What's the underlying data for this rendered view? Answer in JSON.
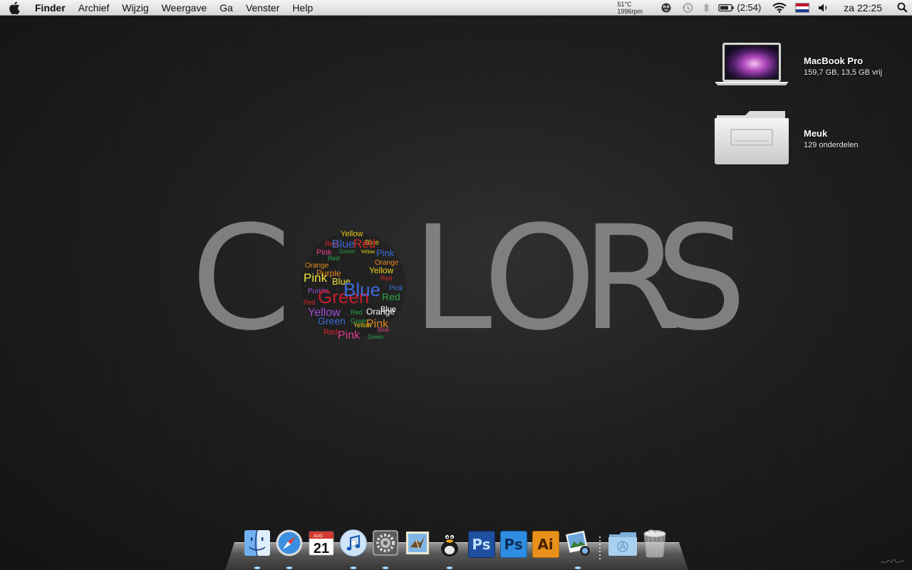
{
  "menubar": {
    "app_name": "Finder",
    "items": [
      "Archief",
      "Wijzig",
      "Weergave",
      "Ga",
      "Venster",
      "Help"
    ],
    "temperature": "51°C",
    "fan_speed": "1996rpm",
    "battery_time": "(2:54)",
    "clock": "za 22:25"
  },
  "desktop": {
    "items": [
      {
        "name": "MacBook Pro",
        "detail": "159,7 GB, 13,5 GB vrij",
        "icon": "laptop-icon"
      },
      {
        "name": "Meuk",
        "detail": "129 onderdelen",
        "icon": "folder-icon"
      }
    ]
  },
  "wallpaper": {
    "letters": [
      "C",
      "L",
      "O",
      "R",
      "S"
    ],
    "cloud_words": [
      {
        "t": "Yellow",
        "c": "#e8d21a"
      },
      {
        "t": "Red",
        "c": "#d8262a"
      },
      {
        "t": "Blue",
        "c": "#3d6bd8"
      },
      {
        "t": "Blue",
        "c": "#f0c21c"
      },
      {
        "t": "Red",
        "c": "#d8262a"
      },
      {
        "t": "Pink",
        "c": "#e23f8e"
      },
      {
        "t": "Green",
        "c": "#2aa44a"
      },
      {
        "t": "Yellow",
        "c": "#e8d21a"
      },
      {
        "t": "Pink",
        "c": "#3d6bd8"
      },
      {
        "t": "Red",
        "c": "#2aa44a"
      },
      {
        "t": "Orange",
        "c": "#e58a1f"
      },
      {
        "t": "Orange",
        "c": "#e58a1f"
      },
      {
        "t": "Purple",
        "c": "#e58a1f"
      },
      {
        "t": "Yellow",
        "c": "#e8d21a"
      },
      {
        "t": "Pink",
        "c": "#f0e13a"
      },
      {
        "t": "Red",
        "c": "#d8262a"
      },
      {
        "t": "Blue",
        "c": "#f0e13a"
      },
      {
        "t": "Purple",
        "c": "#9c4ed8"
      },
      {
        "t": "Pink",
        "c": "#3d6bd8"
      },
      {
        "t": "Red",
        "c": "#d8262a"
      },
      {
        "t": "Green",
        "c": "#c41e2c"
      },
      {
        "t": "Red",
        "c": "#2aa44a"
      },
      {
        "t": "Blue",
        "c": "#3d6bd8"
      },
      {
        "t": "Blue",
        "c": "#ffffff"
      },
      {
        "t": "Yellow",
        "c": "#9c4ed8"
      },
      {
        "t": "Red",
        "c": "#2aa44a"
      },
      {
        "t": "Orange",
        "c": "#ffffff"
      },
      {
        "t": "Green",
        "c": "#3d6bd8"
      },
      {
        "t": "Green",
        "c": "#2aa44a"
      },
      {
        "t": "Yellow",
        "c": "#e8d21a"
      },
      {
        "t": "Pink",
        "c": "#e58a1f"
      },
      {
        "t": "Red",
        "c": "#d8262a"
      },
      {
        "t": "Pink",
        "c": "#e23f8e"
      },
      {
        "t": "Blue",
        "c": "#e23f8e"
      },
      {
        "t": "Green",
        "c": "#2aa44a"
      }
    ]
  },
  "dock": {
    "items": [
      {
        "icon": "finder-icon",
        "running": true
      },
      {
        "icon": "safari-icon",
        "running": true
      },
      {
        "icon": "ical-icon",
        "date_month": "AUG",
        "date_day": "21",
        "running": false
      },
      {
        "icon": "itunes-icon",
        "running": true
      },
      {
        "icon": "system-preferences-icon",
        "running": true
      },
      {
        "icon": "mail-icon",
        "running": false
      },
      {
        "icon": "adium-duck-icon",
        "running": true
      },
      {
        "icon": "photoshop-icon",
        "label": "Ps",
        "running": false
      },
      {
        "icon": "photoshop-cs-icon",
        "label": "Ps",
        "running": false
      },
      {
        "icon": "illustrator-icon",
        "label": "Ai",
        "running": false
      },
      {
        "icon": "iphoto-icon",
        "running": true
      },
      {
        "icon": "applications-folder-icon",
        "running": false
      },
      {
        "icon": "trash-icon",
        "running": false
      }
    ]
  },
  "colors": {
    "menubar_bg": "#e6e6e6",
    "wallpaper_letters": "#7f7f7f",
    "ps_blue": "#1f4f9f",
    "ai_orange": "#e8901a"
  }
}
